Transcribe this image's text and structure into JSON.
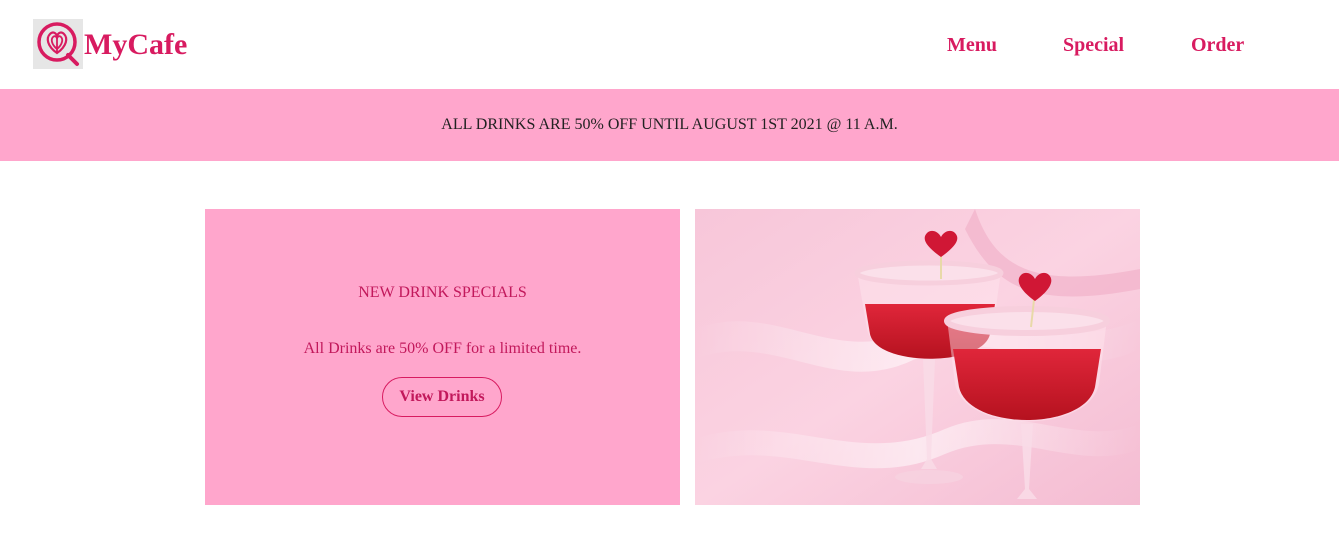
{
  "header": {
    "brand": "MyCafe",
    "logo_icon": "cafe-heart-logo-icon",
    "nav": [
      {
        "label": "Menu"
      },
      {
        "label": "Special"
      },
      {
        "label": "Order"
      }
    ]
  },
  "banner": {
    "text": "ALL DRINKS ARE 50% OFF UNTIL AUGUST 1ST 2021 @ 11 A.M."
  },
  "promo": {
    "title": "NEW DRINK SPECIALS",
    "description": "All Drinks are 50% OFF for a limited time.",
    "button_label": "View Drinks"
  },
  "photo": {
    "subject": "two red cocktails with sugared rims and heart toppers on pink fabric"
  },
  "colors": {
    "brand": "#d81b60",
    "banner_bg": "#ffa6cc",
    "promo_text": "#c2185b"
  }
}
